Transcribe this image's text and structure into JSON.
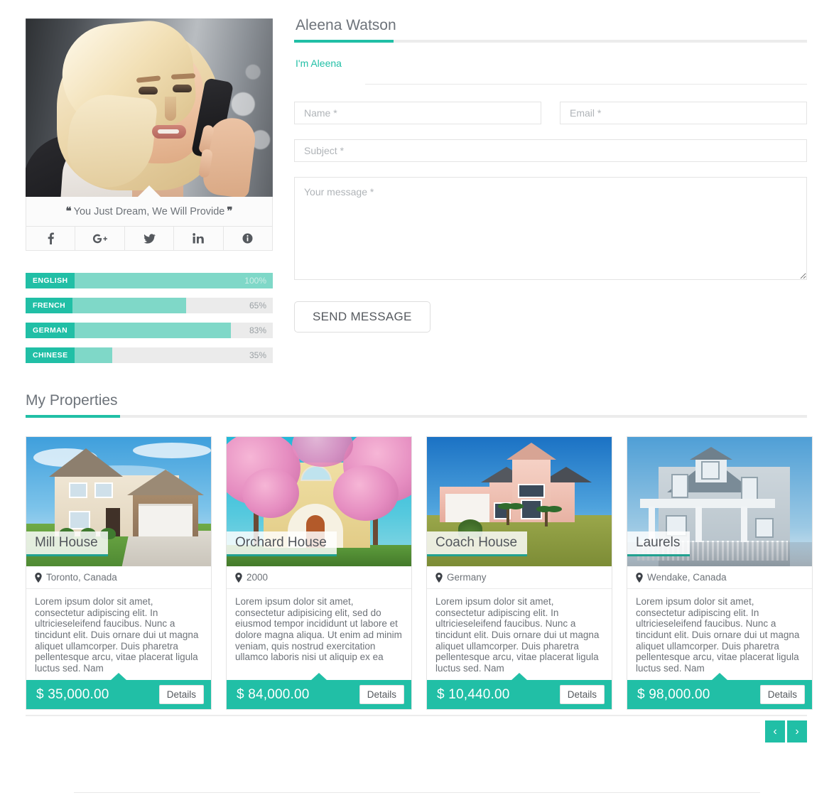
{
  "profile": {
    "photo_alt": "blonde woman talking on mobile phone",
    "quote": "You Just Dream, We Will Provide",
    "quote_open": "❝",
    "quote_close": "❞",
    "social": [
      {
        "name": "facebook",
        "label": "f"
      },
      {
        "name": "google-plus",
        "label": "G+"
      },
      {
        "name": "twitter",
        "label": "t"
      },
      {
        "name": "linkedin",
        "label": "in"
      },
      {
        "name": "info",
        "label": "i"
      }
    ]
  },
  "skills": {
    "items": [
      {
        "label": "ENGLISH",
        "percent": 100,
        "percent_label": "100%"
      },
      {
        "label": "FRENCH",
        "percent": 65,
        "percent_label": "65%"
      },
      {
        "label": "GERMAN",
        "percent": 83,
        "percent_label": "83%"
      },
      {
        "label": "CHINESE",
        "percent": 35,
        "percent_label": "35%"
      }
    ]
  },
  "agent": {
    "name": "Aleena Watson",
    "intro": "I'm Aleena"
  },
  "contact_form": {
    "name_placeholder": "Name *",
    "email_placeholder": "Email *",
    "subject_placeholder": "Subject *",
    "message_placeholder": "Your message *",
    "name_value": "",
    "email_value": "",
    "subject_value": "",
    "message_value": "",
    "submit_label": "SEND MESSAGE"
  },
  "properties": {
    "heading": "My Properties",
    "details_label": "Details",
    "items": [
      {
        "title": "Mill House",
        "location": "Toronto, Canada",
        "description": "Lorem ipsum dolor sit amet, consectetur adipiscing elit. In ultricieseleifend faucibus. Nunc a tincidunt elit. Duis ornare dui ut magna aliquet ullamcorper. Duis pharetra pellentesque arcu, vitae placerat ligula luctus sed. Nam",
        "price": "$ 35,000.00",
        "image_alt": "beige two-story house with white garage door and driveway"
      },
      {
        "title": "Orchard House",
        "location": "2000",
        "description": "Lorem ipsum dolor sit amet, consectetur adipisicing elit, sed do eiusmod tempor incididunt ut labore et dolore magna aliqua. Ut enim ad minim veniam, quis nostrud exercitation ullamco laboris nisi ut aliquip ex ea",
        "price": "$ 84,000.00",
        "image_alt": "yellow house framed by pink flowering crape myrtle trees"
      },
      {
        "title": "Coach House",
        "location": "Germany",
        "description": "Lorem ipsum dolor sit amet, consectetur adipiscing elit. In ultricieseleifend faucibus. Nunc a tincidunt elit. Duis ornare dui ut magna aliquet ullamcorper. Duis pharetra pellentesque arcu, vitae placerat ligula luctus sed. Nam",
        "price": "$ 10,440.00",
        "image_alt": "pink stucco two-story house with palms on a lawn"
      },
      {
        "title": "Laurels",
        "location": "Wendake, Canada",
        "description": "Lorem ipsum dolor sit amet, consectetur adipiscing elit. In ultricieseleifend faucibus. Nunc a tincidunt elit. Duis ornare dui ut magna aliquet ullamcorper. Duis pharetra pellentesque arcu, vitae placerat ligula luctus sed. Nam",
        "price": "$ 98,000.00",
        "image_alt": "grey shingled victorian house with white porch railing"
      }
    ]
  },
  "pager": {
    "prev_label": "‹",
    "next_label": "›"
  },
  "colors": {
    "accent": "#21bfa6",
    "accent_light": "#7fd8c8",
    "accent_dark": "#21a190",
    "text": "#6d7278",
    "border": "#e4e4e4"
  }
}
